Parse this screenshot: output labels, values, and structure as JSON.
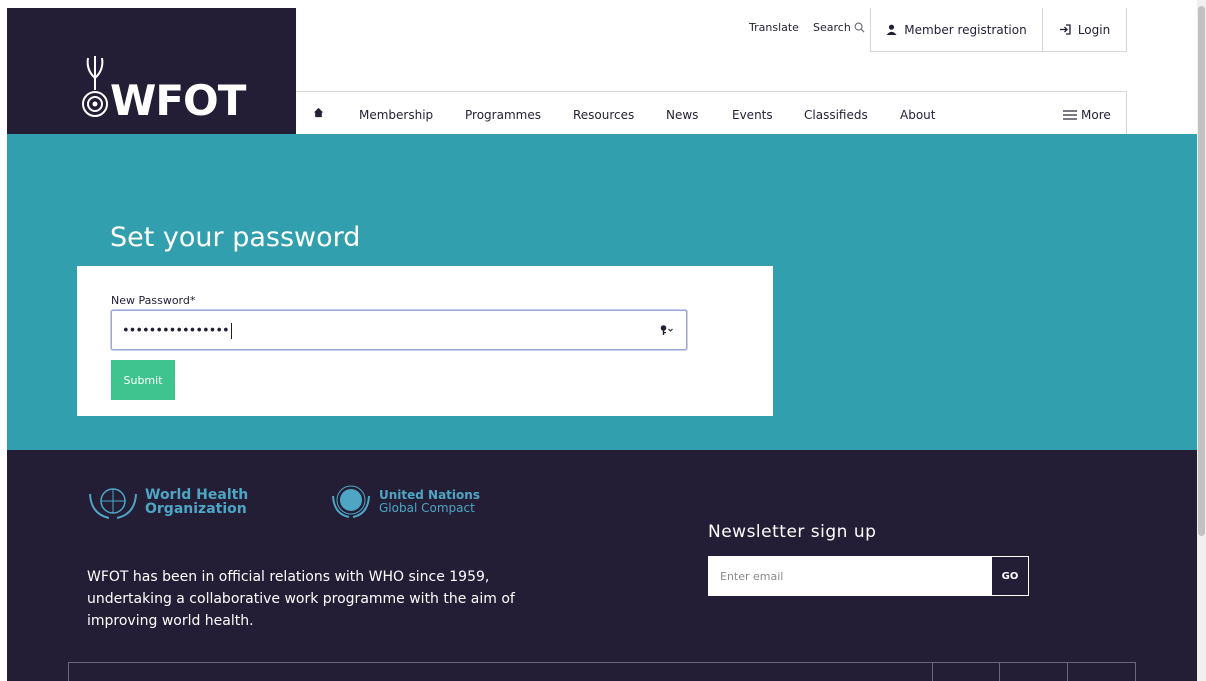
{
  "brand": {
    "name": "WFOT"
  },
  "utility": {
    "translate": "Translate",
    "search": "Search",
    "member_registration": "Member registration",
    "login": "Login"
  },
  "nav": {
    "items": [
      {
        "label": "Membership"
      },
      {
        "label": "Programmes"
      },
      {
        "label": "Resources"
      },
      {
        "label": "News"
      },
      {
        "label": "Events"
      },
      {
        "label": "Classifieds"
      },
      {
        "label": "About"
      }
    ],
    "more": "More"
  },
  "hero": {
    "title": "Set your password"
  },
  "form": {
    "label": "New Password*",
    "value": "••••••••••••••••",
    "submit": "Submit"
  },
  "footer": {
    "partners": [
      {
        "line1": "World Health",
        "line2": "Organization"
      },
      {
        "line1": "United Nations",
        "line2": "Global Compact"
      }
    ],
    "about": "WFOT has been in official relations with WHO since 1959, undertaking a collaborative work programme with the aim of improving world health.",
    "newsletter": {
      "title": "Newsletter sign up",
      "placeholder": "Enter email",
      "go": "GO"
    }
  },
  "colors": {
    "navy": "#231d35",
    "teal": "#319fae",
    "submit_green": "#3fc38f",
    "partner_blue": "#4ea6c4"
  }
}
